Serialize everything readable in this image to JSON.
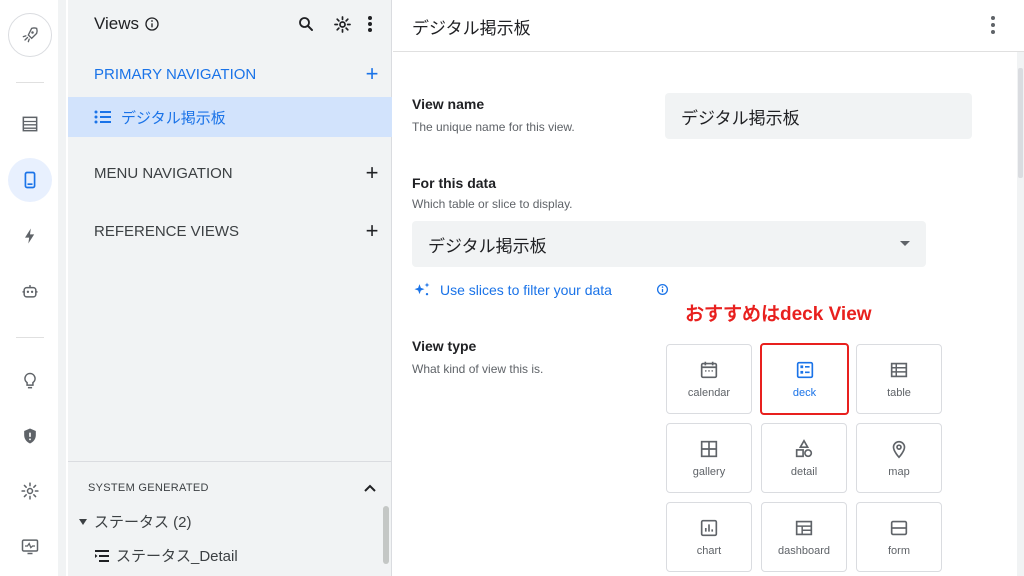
{
  "views_panel": {
    "title": "Views",
    "sections": {
      "primary": "PRIMARY NAVIGATION",
      "menu": "MENU NAVIGATION",
      "reference": "REFERENCE VIEWS",
      "system": "SYSTEM GENERATED"
    },
    "primary_items": [
      "デジタル掲示板"
    ],
    "system_tree": {
      "group_label": "ステータス (2)",
      "child_label": "ステータス_Detail"
    }
  },
  "main": {
    "title": "デジタル掲示板",
    "view_name": {
      "label": "View name",
      "help": "The unique name for this view.",
      "value": "デジタル掲示板"
    },
    "data": {
      "label": "For this data",
      "help": "Which table or slice to display.",
      "value": "デジタル掲示板"
    },
    "slices_link": "Use slices to filter your data",
    "recommend_note": "おすすめはdeck View",
    "view_type": {
      "label": "View type",
      "help": "What kind of view this is.",
      "selected": "deck",
      "options": [
        "calendar",
        "deck",
        "table",
        "gallery",
        "detail",
        "map",
        "chart",
        "dashboard",
        "form"
      ]
    }
  },
  "colors": {
    "accent": "#1a73e8",
    "highlight": "#e8201e",
    "panel_bg": "#f1f3f4",
    "selected_bg": "#d2e3fc"
  },
  "icons": {
    "rail": [
      "rocket-icon",
      "table-icon",
      "phone-icon",
      "bolt-icon",
      "robot-icon",
      "bulb-icon",
      "shield-icon",
      "gear-icon",
      "monitor-icon"
    ]
  }
}
